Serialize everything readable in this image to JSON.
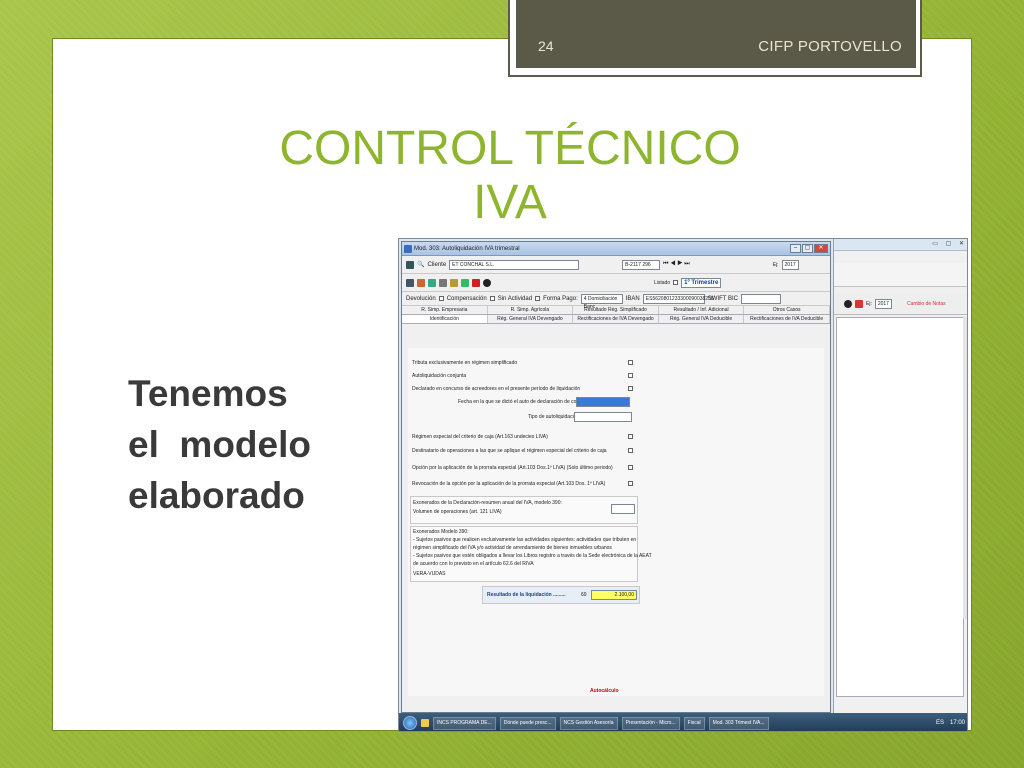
{
  "header": {
    "slide_number": "24",
    "organization": "CIFP PORTOVELLO"
  },
  "title": {
    "line1": "CONTROL TÉCNICO",
    "line2": "IVA"
  },
  "body": {
    "line1": "Tenemos",
    "line2": "el  modelo",
    "line3": "elaborado"
  },
  "screenshot": {
    "window_title": "Mod. 303: Autoliquidación IVA trimestral",
    "client_label": "Cliente",
    "client_name": "ET CONCHAL S.L.",
    "client_nif": "B-2117 296",
    "year_label": "Ej:",
    "year_value": "2017",
    "listado_label": "Listado",
    "period": "1º Trimestre",
    "bg_year": "2017",
    "bg_action": "Cambio de Notas",
    "opts": [
      "Devolución",
      "Compensación",
      "Sin Actividad",
      "Forma Pago:",
      "IBAN",
      "SWIFT BIC"
    ],
    "forma_pago_value": "4 Domiciliación Banc",
    "iban_value": "ES5620801233300090038256",
    "tabs_row1": [
      "R. Simp. Empresaria",
      "R. Simp. Agrícola",
      "Resultado Rég. Simplificado",
      "Resultado / Inf. Adicional",
      "Otros Casos"
    ],
    "tabs_row2": [
      "Identificación",
      "Rég. General IVA Devengado",
      "Rectificaciones de IVA Devengado",
      "Rég. General IVA Deducible",
      "Rectificaciones de IVA Deducible"
    ],
    "fields": [
      "Tributa exclusivamente en régimen simplificado",
      "Autoliquidación conjunta",
      "Declarado en concurso de acreedores en el presente período de liquidación",
      "Fecha en la que se dictó el auto de declaración de concurso",
      "Tipo de autoliquidación",
      "Régimen especial del criterio de caja (Art.163 undecies LIVA)",
      "Destinatario de operaciones a las que se aplique el régimen especial del criterio de caja",
      "Opción por la aplicación de la prorrata especial (Art.103 Dos.1º LIVA) (Solo último periodo)",
      "Revocación de la opción por la aplicación de la prorrata especial (Art.103 Dos. 1º LIVA)"
    ],
    "exonerados": "Exonerados de la Declaración-resumen anual del IVA, modelo 390:",
    "volumen": "Volumen de operaciones (art. 121 LIVA)",
    "notes": [
      "Exonerados Modelo 390:",
      "- Sujetos pasivos que realicen exclusivamente las actividades siguientes: actividades que tributen en",
      "  régimen simplificado del IVA y/o actividad de arrendamiento de bienes inmuebles urbanos",
      "- Sujetos pasivos que estén obligados a llevar los Libros registro a través de la Sede electrónica de la AEAT",
      "  de acuerdo con lo previsto en el artículo 62.6 del RIVA",
      "VERA-VUDAS"
    ],
    "result_label": "Resultado de la liquidación .........",
    "result_code": "69",
    "result_value": "2.100,00",
    "status": "Autocálculo",
    "taskbar": [
      "INCS PROGRAMA DE...",
      "Dónde puede presc...",
      "NCS Gestión Asesoría",
      "Presentación - Micro...",
      "Fiscal",
      "Mod. 303 Trimest IVA..."
    ],
    "tray_lang": "ES",
    "tray_time": "17:00"
  },
  "colors": {
    "title": "#8db52e",
    "frame": "#9ab83a",
    "header": "#5b5a48"
  }
}
